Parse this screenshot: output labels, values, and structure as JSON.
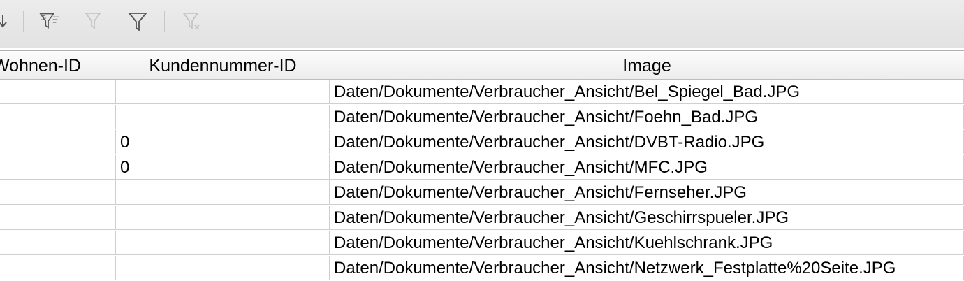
{
  "toolbar": {
    "buttons": [
      {
        "name": "sort-descending-icon",
        "enabled": true
      },
      {
        "name": "autofilter-icon",
        "enabled": true
      },
      {
        "name": "apply-filter-icon",
        "enabled": false
      },
      {
        "name": "standard-filter-icon",
        "enabled": true
      },
      {
        "name": "remove-filter-icon",
        "enabled": false
      }
    ]
  },
  "table": {
    "columns": [
      "Wohnen-ID",
      "Kundennummer-ID",
      "Image"
    ],
    "rows": [
      {
        "wohnen_id": "",
        "kundennummer_id": "",
        "image": "Daten/Dokumente/Verbraucher_Ansicht/Bel_Spiegel_Bad.JPG"
      },
      {
        "wohnen_id": "",
        "kundennummer_id": "",
        "image": "Daten/Dokumente/Verbraucher_Ansicht/Foehn_Bad.JPG"
      },
      {
        "wohnen_id": "",
        "kundennummer_id": "0",
        "image": "Daten/Dokumente/Verbraucher_Ansicht/DVBT-Radio.JPG"
      },
      {
        "wohnen_id": "",
        "kundennummer_id": "0",
        "image": "Daten/Dokumente/Verbraucher_Ansicht/MFC.JPG"
      },
      {
        "wohnen_id": "",
        "kundennummer_id": "",
        "image": "Daten/Dokumente/Verbraucher_Ansicht/Fernseher.JPG"
      },
      {
        "wohnen_id": "",
        "kundennummer_id": "",
        "image": "Daten/Dokumente/Verbraucher_Ansicht/Geschirrspueler.JPG"
      },
      {
        "wohnen_id": "",
        "kundennummer_id": "",
        "image": "Daten/Dokumente/Verbraucher_Ansicht/Kuehlschrank.JPG"
      },
      {
        "wohnen_id": "",
        "kundennummer_id": "",
        "image": "Daten/Dokumente/Verbraucher_Ansicht/Netzwerk_Festplatte%20Seite.JPG"
      }
    ]
  },
  "colors": {
    "toolbar_bg": "#e6e6e6",
    "grid_line": "#cfcfcf",
    "icon_enabled": "#555555",
    "icon_disabled": "#c0c0c0"
  }
}
